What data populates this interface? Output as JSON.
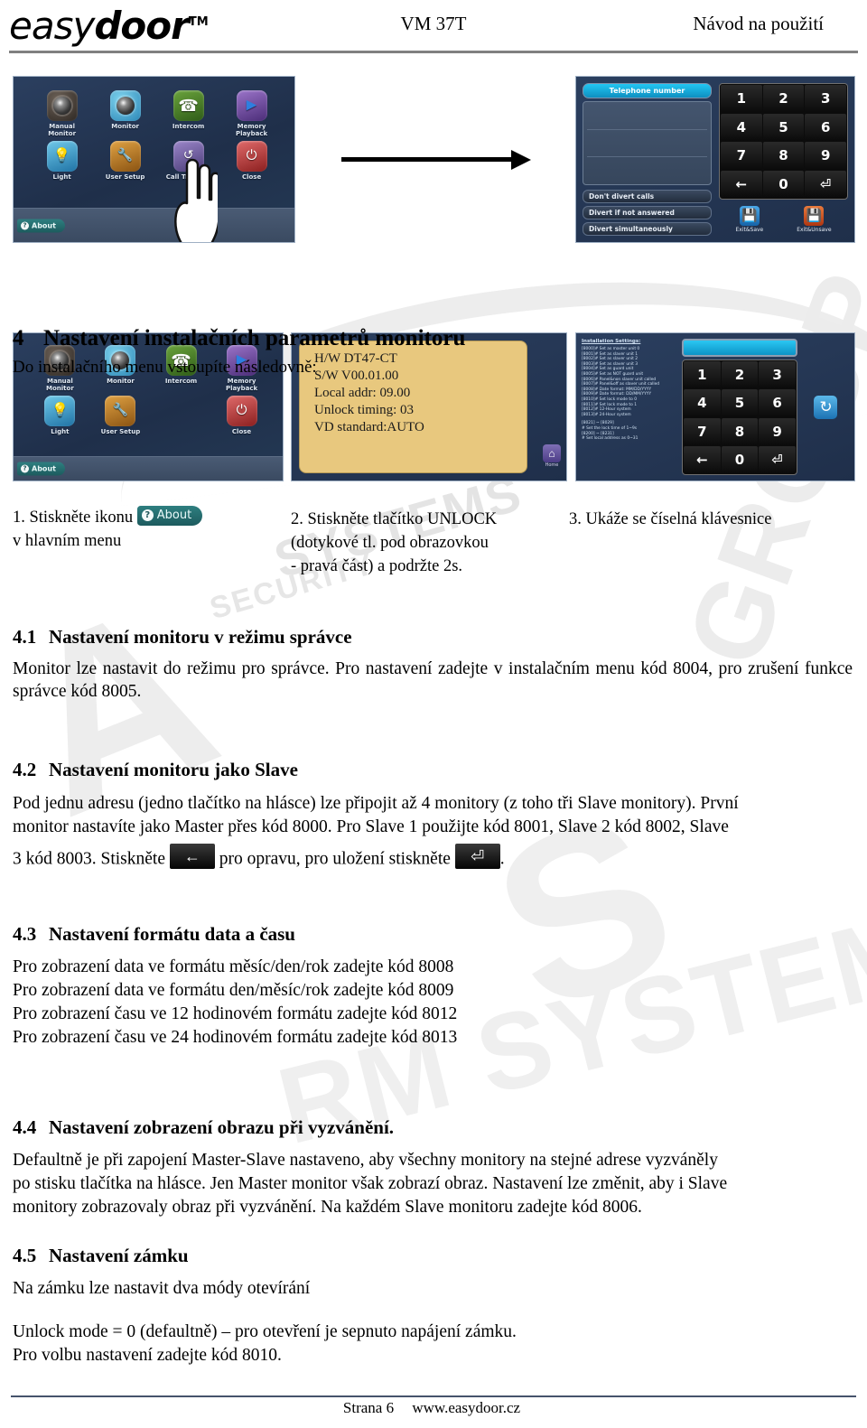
{
  "header": {
    "logo_main": "easydoor",
    "logo_light": "easy",
    "logo_bold": "door",
    "logo_tm": "TM",
    "model": "VM 37T",
    "doc_type": "Návod na použití"
  },
  "watermark": {
    "big_a": "A",
    "systems": "SYSTEMS",
    "security": "SECURITY",
    "group": "GROUP",
    "s_letter": "S",
    "rm": "RM SYSTEMS"
  },
  "screens": {
    "main_menu": {
      "items": [
        {
          "label": "Manual\nMonitor",
          "icon": "camera-lens-icon"
        },
        {
          "label": "Monitor",
          "icon": "camera-lens-icon"
        },
        {
          "label": "Intercom",
          "icon": "phone-handset-icon"
        },
        {
          "label": "Memory\nPlayback",
          "icon": "play-icon"
        },
        {
          "label": "Light",
          "icon": "lightbulb-icon"
        },
        {
          "label": "User Setup",
          "icon": "tools-icon"
        },
        {
          "label": "Call Transfer",
          "icon": "call-transfer-icon"
        },
        {
          "label": "Close",
          "icon": "power-icon"
        }
      ],
      "about_label": "About",
      "about_qmark": "?"
    },
    "call_transfer": {
      "field_label": "Telephone number",
      "options": [
        "Don't divert calls",
        "Divert if not answered",
        "Divert simultaneously"
      ],
      "keys": [
        "1",
        "2",
        "3",
        "4",
        "5",
        "6",
        "7",
        "8",
        "9",
        "←",
        "0",
        "⏎"
      ],
      "save_label": "Exit&Save",
      "unsave_label": "Exit&Unsave"
    },
    "about_info": {
      "lines": [
        "H/W    DT47-CT",
        "S/W    V00.01.00",
        "Local addr:   09.00",
        "Unlock timing:  03",
        "VD standard:AUTO"
      ],
      "home_label": "Home"
    },
    "installation": {
      "title": "Installation Settings:",
      "rows": [
        "[8000]# Set as master unit 0",
        "[8001]# Set as slaver unit 1",
        "[8002]# Set as slaver unit 2",
        "[8003]# Set as slaver unit 3",
        "[8004]# Set as guard unit",
        "[8005]# Set as NOT guard unit",
        "[8006]# Panel&non slaver unit called",
        "[8007]# Panel&off as slaver unit called",
        "[8008]# Date format: MM/DD/YYYY",
        "[8009]# Date format: DD/MM/YYYY",
        "[8010]# Set lock mode to 0",
        "[8011]# Set lock mode to 1",
        "[8012]# 12-Hour system",
        "[8013]# 24-Hour system"
      ],
      "rows2": [
        "[8021] ~ [8029]",
        "      # Set the lock time of 1~9s",
        "[8200] ~ [8231]",
        "      # Set local address as 0~31"
      ],
      "keys": [
        "1",
        "2",
        "3",
        "4",
        "5",
        "6",
        "7",
        "8",
        "9",
        "←",
        "0",
        "⏎"
      ],
      "reload_icon": "reload-icon"
    }
  },
  "section4": {
    "number": "4",
    "title": "Nastavení instalačních parametrů monitoru",
    "intro": "Do instalačního menu vstoupíte následovně:",
    "steps": {
      "step1_a": "1. Stiskněte ikonu",
      "step1_btn": "About",
      "step1_qmark": "?",
      "step1_b": "v hlavním menu",
      "step2_l1": "2. Stiskněte tlačítko UNLOCK",
      "step2_l2": "(dotykové tl. pod obrazovkou",
      "step2_l3": "- pravá část) a podržte 2s.",
      "step3": "3. Ukáže se číselná klávesnice"
    }
  },
  "section41": {
    "number": "4.1",
    "title": "Nastavení monitoru v režimu správce",
    "body": "Monitor lze nastavit do režimu pro správce. Pro nastavení zadejte v instalačním menu kód 8004, pro zrušení funkce správce kód 8005."
  },
  "section42": {
    "number": "4.2",
    "title": "Nastavení monitoru jako Slave",
    "body_l1": "Pod jednu adresu (jedno tlačítko na hlásce) lze připojit až 4 monitory (z toho tři Slave monitory). První",
    "body_l2": "monitor nastavíte jako Master přes kód 8000. Pro Slave 1 použijte kód 8001, Slave 2 kód 8002, Slave",
    "body_l3_a": "3 kód 8003. Stiskněte",
    "key_back": "←",
    "body_l3_b": "pro opravu, pro uložení stiskněte",
    "key_enter": "⏎",
    "body_l3_c": "."
  },
  "section43": {
    "number": "4.3",
    "title": "Nastavení formátu data a času",
    "lines": [
      "Pro zobrazení data ve formátu měsíc/den/rok zadejte kód 8008",
      "Pro zobrazení data ve formátu den/měsíc/rok zadejte kód 8009",
      "Pro zobrazení času ve 12 hodinovém formátu zadejte kód 8012",
      "Pro zobrazení času ve 24 hodinovém formátu zadejte kód 8013"
    ]
  },
  "section44": {
    "number": "4.4",
    "title": "Nastavení zobrazení obrazu při vyzvánění.",
    "body_l1": "Defaultně je při zapojení Master-Slave nastaveno, aby všechny monitory na stejné adrese vyzváněly",
    "body_l2": "po stisku tlačítka na hlásce. Jen Master monitor však zobrazí obraz. Nastavení lze změnit, aby i Slave",
    "body_l3": "monitory zobrazovaly obraz při vyzvánění. Na každém Slave monitoru zadejte kód 8006."
  },
  "section45": {
    "number": "4.5",
    "title": "Nastavení zámku",
    "body_l1": "Na zámku lze nastavit dva módy otevírání",
    "body_l2": "Unlock mode = 0 (defaultně) – pro otevření je sepnuto napájení zámku.",
    "body_l3": "Pro volbu nastavení zadejte kód 8010."
  },
  "footer": {
    "page": "Strana 6",
    "url": "www.easydoor.cz"
  },
  "colors": {
    "rule": "#808080",
    "screen_bg": "#233554",
    "about_btn": "#1d5b5e",
    "info_card": "#e8c87e",
    "keypad_bg": "#0c0c0c"
  }
}
